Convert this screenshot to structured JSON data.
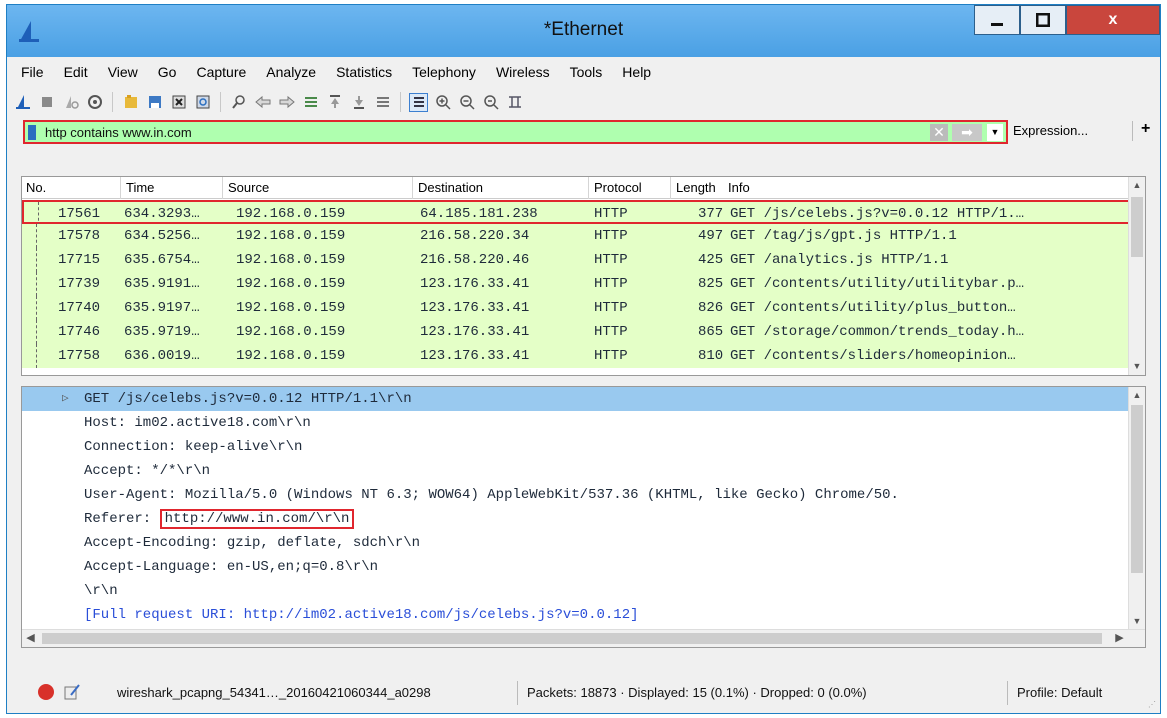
{
  "window": {
    "title": "*Ethernet",
    "close_label": "x"
  },
  "menu": [
    "File",
    "Edit",
    "View",
    "Go",
    "Capture",
    "Analyze",
    "Statistics",
    "Telephony",
    "Wireless",
    "Tools",
    "Help"
  ],
  "toolbar_icons": [
    "start-capture-icon",
    "stop-capture-icon",
    "restart-capture-icon",
    "capture-options-icon",
    "open-file-icon",
    "save-file-icon",
    "close-file-icon",
    "reload-file-icon",
    "find-packet-icon",
    "go-back-icon",
    "go-forward-icon",
    "go-to-packet-icon",
    "first-packet-icon",
    "last-packet-icon",
    "autoscroll-icon",
    "colorize-icon",
    "zoom-in-icon",
    "zoom-out-icon",
    "normal-size-icon",
    "resize-columns-icon"
  ],
  "filter": {
    "value": "http contains www.in.com",
    "expression_label": "Expression...",
    "add_label": "+"
  },
  "packet_list": {
    "columns": [
      "No.",
      "Time",
      "Source",
      "Destination",
      "Protocol",
      "Length",
      "Info"
    ],
    "rows": [
      {
        "no": "17561",
        "time": "634.3293…",
        "source": "192.168.0.159",
        "destination": "64.185.181.238",
        "protocol": "HTTP",
        "length": "377",
        "info": "GET /js/celebs.js?v=0.0.12 HTTP/1.…"
      },
      {
        "no": "17578",
        "time": "634.5256…",
        "source": "192.168.0.159",
        "destination": "216.58.220.34",
        "protocol": "HTTP",
        "length": "497",
        "info": "GET /tag/js/gpt.js HTTP/1.1"
      },
      {
        "no": "17715",
        "time": "635.6754…",
        "source": "192.168.0.159",
        "destination": "216.58.220.46",
        "protocol": "HTTP",
        "length": "425",
        "info": "GET /analytics.js HTTP/1.1"
      },
      {
        "no": "17739",
        "time": "635.9191…",
        "source": "192.168.0.159",
        "destination": "123.176.33.41",
        "protocol": "HTTP",
        "length": "825",
        "info": "GET /contents/utility/utilitybar.p…"
      },
      {
        "no": "17740",
        "time": "635.9197…",
        "source": "192.168.0.159",
        "destination": "123.176.33.41",
        "protocol": "HTTP",
        "length": "826",
        "info": "GET /contents/utility/plus_button…"
      },
      {
        "no": "17746",
        "time": "635.9719…",
        "source": "192.168.0.159",
        "destination": "123.176.33.41",
        "protocol": "HTTP",
        "length": "865",
        "info": "GET /storage/common/trends_today.h…"
      },
      {
        "no": "17758",
        "time": "636.0019…",
        "source": "192.168.0.159",
        "destination": "123.176.33.41",
        "protocol": "HTTP",
        "length": "810",
        "info": "GET /contents/sliders/homeopinion…"
      }
    ]
  },
  "details": {
    "request_line": "GET /js/celebs.js?v=0.0.12 HTTP/1.1\\r\\n",
    "host": "Host: im02.active18.com\\r\\n",
    "connection": "Connection: keep-alive\\r\\n",
    "accept": "Accept: */*\\r\\n",
    "user_agent": "User-Agent: Mozilla/5.0 (Windows NT 6.3; WOW64) AppleWebKit/537.36 (KHTML, like Gecko) Chrome/50.",
    "referer_label": "Referer: ",
    "referer_value": "http://www.in.com/\\r\\n",
    "accept_encoding": "Accept-Encoding: gzip, deflate, sdch\\r\\n",
    "accept_language": "Accept-Language: en-US,en;q=0.8\\r\\n",
    "crlf": "\\r\\n",
    "full_uri": "[Full request URI: http://im02.active18.com/js/celebs.js?v=0.0.12]"
  },
  "status": {
    "file": "wireshark_pcapng_54341…_20160421060344_a0298",
    "packets": "Packets: 18873 · Displayed: 15 (0.1%) · Dropped: 0 (0.0%)",
    "profile": "Profile: Default"
  },
  "colors": {
    "filter_valid": "#afffaf",
    "http_row": "#e4ffc7",
    "selected_detail": "#99c9ef",
    "highlight_box": "#e0262e"
  }
}
